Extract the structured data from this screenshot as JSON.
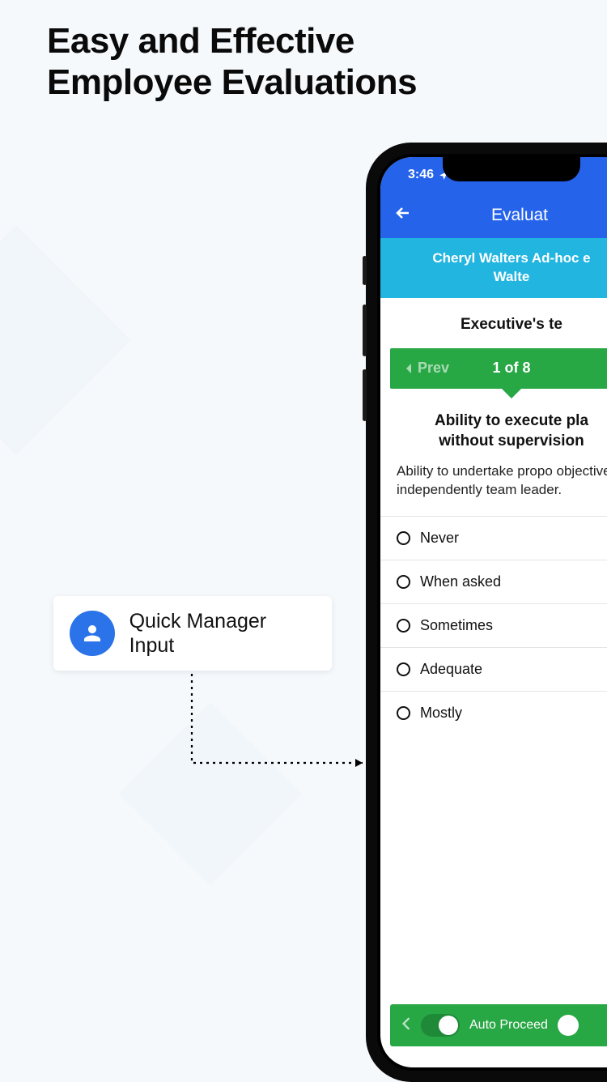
{
  "headline_line1": "Easy and Effective",
  "headline_line2": "Employee Evaluations",
  "callout": {
    "label": "Quick Manager Input"
  },
  "status": {
    "time": "3:46"
  },
  "nav": {
    "title": "Evaluat"
  },
  "subheader_line1": "Cheryl Walters Ad-hoc e",
  "subheader_line2": "Walte",
  "section_title": "Executive's te",
  "pager": {
    "prev": "Prev",
    "count": "1 of 8"
  },
  "question": {
    "title_line1": "Ability to execute pla",
    "title_line2": "without supervision",
    "desc": "Ability to undertake propo objectives independently team leader."
  },
  "options": [
    "Never",
    "When asked",
    "Sometimes",
    "Adequate",
    "Mostly"
  ],
  "footer": {
    "label": "Auto Proceed"
  },
  "colors": {
    "primary_blue": "#2563eb",
    "cyan": "#22b5e0",
    "green": "#28a745",
    "avatar_blue": "#2a73e8"
  }
}
